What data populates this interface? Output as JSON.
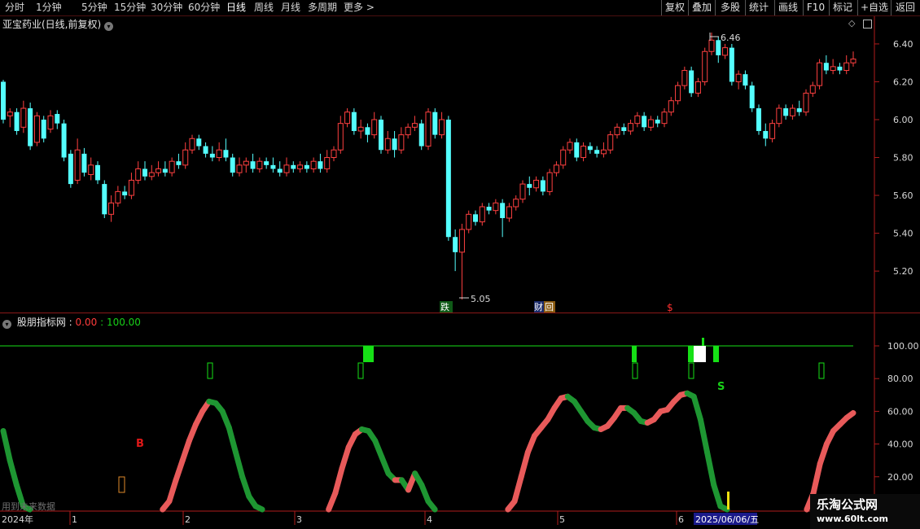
{
  "toolbar": {
    "periods": [
      "分时",
      "1分钟",
      "5分钟",
      "15分钟",
      "30分钟",
      "60分钟",
      "日线",
      "周线",
      "月线",
      "多周期",
      "更多"
    ],
    "active_period": "日线",
    "right_buttons": [
      "复权",
      "叠加",
      "多股",
      "统计",
      "画线",
      "F10",
      "标记",
      "+自选",
      "返回"
    ]
  },
  "stock": {
    "title": "亚宝药业(日线,前复权)",
    "price_axis": [
      "6.40",
      "6.20",
      "6.00",
      "5.80",
      "5.60",
      "5.40",
      "5.20"
    ],
    "high_label": "6.46",
    "low_label": "5.05",
    "markers": [
      "跌",
      "财",
      "回",
      "$"
    ]
  },
  "indicator": {
    "name": "股朋指标网",
    "value1": "0.00",
    "value2": "100.00",
    "axis": [
      "100.00",
      "80.00",
      "60.00",
      "40.00",
      "20.00"
    ],
    "buy_label": "B",
    "sell_label": "S"
  },
  "time_axis": {
    "labels": [
      "2024年",
      "1",
      "2",
      "3",
      "4",
      "5",
      "6"
    ],
    "cursor_date": "2025/06/06/五"
  },
  "hint_text": "用到未来数据",
  "watermark": {
    "line1": "乐淘公式网",
    "line2": "www.60lt.com"
  },
  "colors": {
    "up": "#ff4040",
    "down": "#54ffff",
    "osc_up": "#e85a5a",
    "osc_down": "#1e9632",
    "signal_green": "#16e016",
    "axis_red": "#b01c1c"
  },
  "chart_data": {
    "type": "candlestick",
    "y_range": [
      5.05,
      6.46
    ],
    "y_ticks": [
      5.2,
      5.4,
      5.6,
      5.8,
      6.0,
      6.2,
      6.4
    ],
    "candles": [
      [
        6.2,
        6.0,
        6.21,
        5.98
      ],
      [
        6.02,
        6.04,
        6.06,
        5.96
      ],
      [
        6.04,
        5.94,
        6.06,
        5.92
      ],
      [
        5.96,
        6.06,
        6.1,
        5.93
      ],
      [
        6.06,
        5.86,
        6.09,
        5.84
      ],
      [
        5.88,
        6.02,
        6.04,
        5.86
      ],
      [
        6.0,
        5.9,
        6.02,
        5.88
      ],
      [
        5.95,
        6.02,
        6.05,
        5.93
      ],
      [
        6.03,
        5.98,
        6.05,
        5.95
      ],
      [
        5.98,
        5.8,
        6.0,
        5.78
      ],
      [
        5.82,
        5.66,
        5.84,
        5.64
      ],
      [
        5.68,
        5.84,
        5.9,
        5.66
      ],
      [
        5.82,
        5.72,
        5.85,
        5.7
      ],
      [
        5.71,
        5.76,
        5.8,
        5.68
      ],
      [
        5.76,
        5.68,
        5.78,
        5.66
      ],
      [
        5.66,
        5.5,
        5.68,
        5.48
      ],
      [
        5.5,
        5.56,
        5.6,
        5.46
      ],
      [
        5.56,
        5.62,
        5.65,
        5.54
      ],
      [
        5.62,
        5.6,
        5.65,
        5.58
      ],
      [
        5.6,
        5.68,
        5.72,
        5.58
      ],
      [
        5.68,
        5.74,
        5.78,
        5.66
      ],
      [
        5.74,
        5.7,
        5.78,
        5.68
      ],
      [
        5.7,
        5.72,
        5.76,
        5.68
      ],
      [
        5.72,
        5.74,
        5.78,
        5.7
      ],
      [
        5.74,
        5.72,
        5.78,
        5.7
      ],
      [
        5.72,
        5.78,
        5.8,
        5.7
      ],
      [
        5.78,
        5.76,
        5.82,
        5.74
      ],
      [
        5.76,
        5.84,
        5.88,
        5.74
      ],
      [
        5.84,
        5.9,
        5.92,
        5.82
      ],
      [
        5.9,
        5.86,
        5.92,
        5.84
      ],
      [
        5.86,
        5.82,
        5.88,
        5.8
      ],
      [
        5.82,
        5.8,
        5.86,
        5.78
      ],
      [
        5.8,
        5.84,
        5.88,
        5.78
      ],
      [
        5.84,
        5.8,
        5.9,
        5.78
      ],
      [
        5.8,
        5.72,
        5.82,
        5.7
      ],
      [
        5.72,
        5.76,
        5.8,
        5.7
      ],
      [
        5.76,
        5.78,
        5.8,
        5.72
      ],
      [
        5.78,
        5.74,
        5.82,
        5.72
      ],
      [
        5.74,
        5.78,
        5.8,
        5.72
      ],
      [
        5.78,
        5.76,
        5.8,
        5.74
      ],
      [
        5.76,
        5.74,
        5.8,
        5.72
      ],
      [
        5.74,
        5.72,
        5.78,
        5.7
      ],
      [
        5.72,
        5.76,
        5.8,
        5.7
      ],
      [
        5.76,
        5.74,
        5.78,
        5.72
      ],
      [
        5.74,
        5.76,
        5.78,
        5.72
      ],
      [
        5.76,
        5.74,
        5.78,
        5.72
      ],
      [
        5.74,
        5.78,
        5.8,
        5.72
      ],
      [
        5.78,
        5.74,
        5.82,
        5.72
      ],
      [
        5.74,
        5.8,
        5.84,
        5.72
      ],
      [
        5.8,
        5.84,
        5.86,
        5.78
      ],
      [
        5.84,
        5.98,
        6.02,
        5.82
      ],
      [
        5.98,
        6.04,
        6.06,
        5.96
      ],
      [
        6.04,
        5.94,
        6.06,
        5.92
      ],
      [
        5.94,
        5.96,
        6.0,
        5.9
      ],
      [
        5.96,
        5.92,
        5.98,
        5.88
      ],
      [
        5.92,
        6.0,
        6.04,
        5.9
      ],
      [
        6.0,
        5.84,
        6.02,
        5.82
      ],
      [
        5.84,
        5.9,
        5.94,
        5.82
      ],
      [
        5.9,
        5.84,
        5.94,
        5.8
      ],
      [
        5.84,
        5.92,
        5.96,
        5.82
      ],
      [
        5.92,
        5.96,
        5.98,
        5.9
      ],
      [
        5.96,
        5.98,
        6.02,
        5.94
      ],
      [
        5.98,
        5.86,
        6.0,
        5.84
      ],
      [
        5.86,
        6.04,
        6.06,
        5.84
      ],
      [
        6.04,
        5.92,
        6.06,
        5.9
      ],
      [
        5.92,
        6.0,
        6.04,
        5.9
      ],
      [
        6.0,
        5.38,
        6.02,
        5.36
      ],
      [
        5.38,
        5.3,
        5.42,
        5.2
      ],
      [
        5.3,
        5.42,
        5.45,
        5.05
      ],
      [
        5.42,
        5.5,
        5.52,
        5.4
      ],
      [
        5.5,
        5.46,
        5.52,
        5.44
      ],
      [
        5.46,
        5.54,
        5.56,
        5.44
      ],
      [
        5.54,
        5.52,
        5.56,
        5.5
      ],
      [
        5.52,
        5.56,
        5.58,
        5.5
      ],
      [
        5.56,
        5.48,
        5.58,
        5.38
      ],
      [
        5.48,
        5.54,
        5.56,
        5.46
      ],
      [
        5.54,
        5.58,
        5.6,
        5.52
      ],
      [
        5.58,
        5.66,
        5.68,
        5.56
      ],
      [
        5.66,
        5.64,
        5.7,
        5.6
      ],
      [
        5.64,
        5.68,
        5.7,
        5.62
      ],
      [
        5.68,
        5.62,
        5.7,
        5.6
      ],
      [
        5.62,
        5.72,
        5.74,
        5.6
      ],
      [
        5.72,
        5.76,
        5.78,
        5.7
      ],
      [
        5.76,
        5.84,
        5.86,
        5.74
      ],
      [
        5.84,
        5.88,
        5.9,
        5.82
      ],
      [
        5.88,
        5.8,
        5.9,
        5.78
      ],
      [
        5.8,
        5.86,
        5.88,
        5.78
      ],
      [
        5.86,
        5.84,
        5.88,
        5.82
      ],
      [
        5.84,
        5.82,
        5.86,
        5.8
      ],
      [
        5.82,
        5.84,
        5.88,
        5.8
      ],
      [
        5.84,
        5.92,
        5.94,
        5.82
      ],
      [
        5.92,
        5.96,
        5.98,
        5.9
      ],
      [
        5.96,
        5.94,
        5.98,
        5.92
      ],
      [
        5.94,
        5.98,
        6.0,
        5.92
      ],
      [
        5.98,
        6.02,
        6.04,
        5.96
      ],
      [
        6.02,
        5.96,
        6.04,
        5.94
      ],
      [
        5.96,
        6.0,
        6.02,
        5.94
      ],
      [
        6.0,
        5.98,
        6.02,
        5.96
      ],
      [
        5.98,
        6.04,
        6.06,
        5.96
      ],
      [
        6.04,
        6.1,
        6.12,
        6.02
      ],
      [
        6.1,
        6.18,
        6.2,
        6.08
      ],
      [
        6.18,
        6.26,
        6.28,
        6.16
      ],
      [
        6.26,
        6.14,
        6.28,
        6.12
      ],
      [
        6.14,
        6.2,
        6.22,
        6.12
      ],
      [
        6.2,
        6.36,
        6.38,
        6.18
      ],
      [
        6.36,
        6.42,
        6.46,
        6.34
      ],
      [
        6.42,
        6.34,
        6.44,
        6.3
      ],
      [
        6.34,
        6.38,
        6.4,
        6.32
      ],
      [
        6.38,
        6.2,
        6.4,
        6.18
      ],
      [
        6.2,
        6.24,
        6.26,
        6.16
      ],
      [
        6.24,
        6.18,
        6.26,
        6.16
      ],
      [
        6.18,
        6.06,
        6.2,
        6.04
      ],
      [
        6.06,
        5.94,
        6.08,
        5.92
      ],
      [
        5.94,
        5.9,
        5.98,
        5.86
      ],
      [
        5.9,
        5.98,
        6.0,
        5.88
      ],
      [
        5.98,
        6.06,
        6.08,
        5.96
      ],
      [
        6.06,
        6.02,
        6.08,
        6.0
      ],
      [
        6.02,
        6.06,
        6.08,
        6.0
      ],
      [
        6.06,
        6.04,
        6.1,
        6.02
      ],
      [
        6.04,
        6.14,
        6.16,
        6.02
      ],
      [
        6.14,
        6.18,
        6.2,
        6.12
      ],
      [
        6.18,
        6.3,
        6.32,
        6.16
      ],
      [
        6.3,
        6.26,
        6.34,
        6.24
      ],
      [
        6.26,
        6.28,
        6.32,
        6.24
      ],
      [
        6.28,
        6.26,
        6.3,
        6.24
      ],
      [
        6.26,
        6.3,
        6.34,
        6.24
      ],
      [
        6.3,
        6.32,
        6.36,
        6.28
      ]
    ],
    "oscillator": {
      "y_range": [
        0,
        100
      ],
      "y_ticks": [
        20,
        40,
        60,
        80,
        100
      ],
      "threshold": 100,
      "values": [
        48,
        30,
        15,
        2,
        0,
        0,
        0,
        0,
        0,
        0,
        0,
        0,
        0,
        0,
        0,
        0,
        0,
        0,
        0,
        0,
        0,
        0,
        0,
        0,
        0,
        5,
        18,
        30,
        42,
        52,
        60,
        66,
        65,
        60,
        50,
        35,
        20,
        8,
        2,
        0,
        0,
        0,
        0,
        0,
        0,
        0,
        0,
        0,
        0,
        0,
        10,
        25,
        38,
        46,
        49,
        48,
        42,
        32,
        22,
        18,
        18,
        12,
        22,
        15,
        5,
        0,
        0,
        0,
        0,
        0,
        0,
        0,
        0,
        0,
        0,
        0,
        0,
        5,
        20,
        35,
        45,
        50,
        55,
        62,
        68,
        69,
        66,
        60,
        54,
        50,
        49,
        51,
        56,
        62,
        62,
        59,
        54,
        53,
        55,
        60,
        61,
        66,
        70,
        71,
        69,
        55,
        35,
        15,
        2,
        0,
        0,
        0,
        0,
        0,
        0,
        0,
        0,
        0,
        0,
        0,
        0,
        0,
        10,
        28,
        40,
        48,
        52,
        56,
        59
      ]
    }
  }
}
